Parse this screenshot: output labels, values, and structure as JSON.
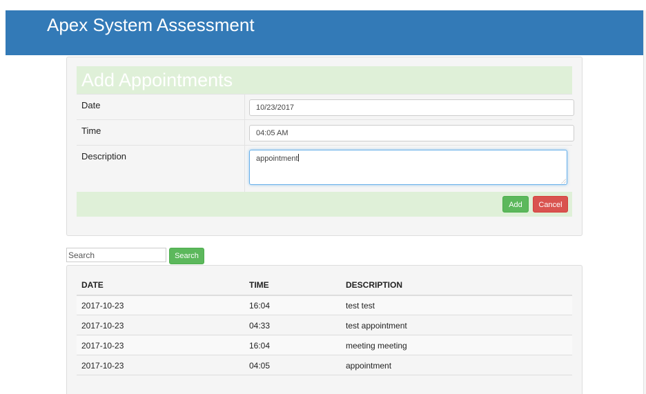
{
  "header": {
    "title": "Apex System Assessment"
  },
  "form": {
    "title": "Add Appointments",
    "fields": [
      {
        "label": "Date",
        "value": "10/23/2017"
      },
      {
        "label": "Time",
        "value": "04:05 AM"
      },
      {
        "label": "Description",
        "value": "appointment"
      }
    ],
    "add_label": "Add",
    "cancel_label": "Cancel"
  },
  "search": {
    "placeholder": "Search",
    "button_label": "Search"
  },
  "table": {
    "columns": [
      "DATE",
      "TIME",
      "DESCRIPTION"
    ],
    "rows": [
      {
        "date": "2017-10-23",
        "time": "16:04",
        "description": "test test"
      },
      {
        "date": "2017-10-23",
        "time": "04:33",
        "description": "test appointment"
      },
      {
        "date": "2017-10-23",
        "time": "16:04",
        "description": "meeting meeting"
      },
      {
        "date": "2017-10-23",
        "time": "04:05",
        "description": "appointment"
      }
    ]
  },
  "colors": {
    "header_bg": "#337ab7",
    "panel_header_bg": "#dff0d8",
    "success": "#5cb85c",
    "danger": "#d9534f",
    "focus": "#66afe9"
  }
}
